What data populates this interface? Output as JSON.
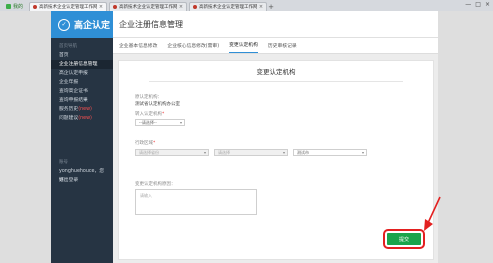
{
  "browser": {
    "bookmark_label": "我的",
    "tabs": [
      {
        "label": "高新技术企业认定管理工作网",
        "active": true
      },
      {
        "label": "高新技术企业认定管理工作网",
        "active": false
      },
      {
        "label": "高新技术企业认定管理工作网",
        "active": false
      }
    ],
    "new_tab_symbol": "+",
    "window_controls": [
      "—",
      "□",
      "×"
    ]
  },
  "sidebar": {
    "logo_text": "高企认定",
    "section_label": "首页导航",
    "items": [
      {
        "label": "首页",
        "active": false
      },
      {
        "label": "企业注册信息管理",
        "active": true
      },
      {
        "label": "高企认定申报",
        "active": false
      },
      {
        "label": "企业年报",
        "active": false
      },
      {
        "label": "查询高企证书",
        "active": false
      },
      {
        "label": "查询申报结果",
        "active": false
      },
      {
        "label": "服务历史",
        "badge": "(new)",
        "active": false
      },
      {
        "label": "问题建议",
        "badge": "(new)",
        "active": false
      }
    ],
    "user_section_label": "账号",
    "username": "yonghuehouce，您好！",
    "logout_label": "退出登录"
  },
  "main": {
    "page_title": "企业注册信息管理",
    "subtabs": [
      {
        "label": "企业基本信息修改",
        "active": false
      },
      {
        "label": "企业核心信息修改(需审)",
        "active": false
      },
      {
        "label": "变更认定机构",
        "active": true
      },
      {
        "label": "历史审核记录",
        "active": false
      }
    ],
    "form": {
      "title": "变更认定机构",
      "current_org_label": "原认定机构：",
      "current_org_value": "测试省认定机构办公室",
      "target_org_label": "转入认定机构",
      "target_org_select": "--请选择--",
      "region_label": "行政区域",
      "region_province": "请选择省份",
      "region_city": "请选择",
      "region_district": "测试市",
      "reason_label": "变更认定机构原因：",
      "reason_placeholder": "请输入",
      "submit_label": "提交"
    }
  },
  "colors": {
    "sidebar_bg": "#263443",
    "logo_bg": "#2f8fd6",
    "submit_bg": "#1aa44b",
    "highlight": "#e32020"
  }
}
